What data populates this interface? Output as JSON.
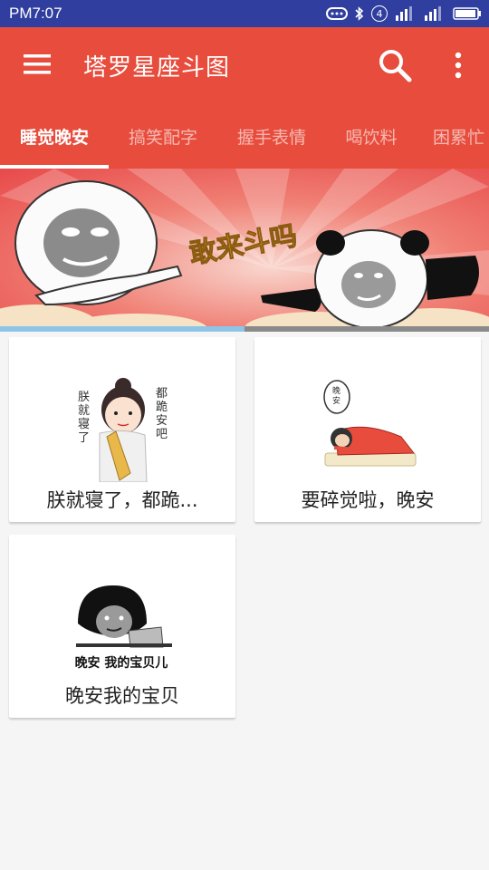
{
  "status_bar": {
    "time": "PM7:07",
    "sim_badge": "4"
  },
  "app_bar": {
    "title": "塔罗星座斗图",
    "menu_icon": "menu-icon",
    "search_icon": "search-icon",
    "more_icon": "more-vert-icon",
    "color": "#e74c3c"
  },
  "tabs": [
    {
      "label": "睡觉晚安",
      "active": true
    },
    {
      "label": "搞笑配字",
      "active": false
    },
    {
      "label": "握手表情",
      "active": false
    },
    {
      "label": "喝饮料",
      "active": false
    },
    {
      "label": "困累忙",
      "active": false
    }
  ],
  "banner": {
    "text": "敢来斗吗"
  },
  "cards": [
    {
      "label": "朕就寝了，都跪...",
      "image_text_left": "朕就寝了",
      "image_text_right": "都跪安吧"
    },
    {
      "label": "要碎觉啦，晚安",
      "image_text": "晚安"
    },
    {
      "label": "晚安我的宝贝",
      "image_text": "晚安 我的宝贝儿"
    }
  ]
}
